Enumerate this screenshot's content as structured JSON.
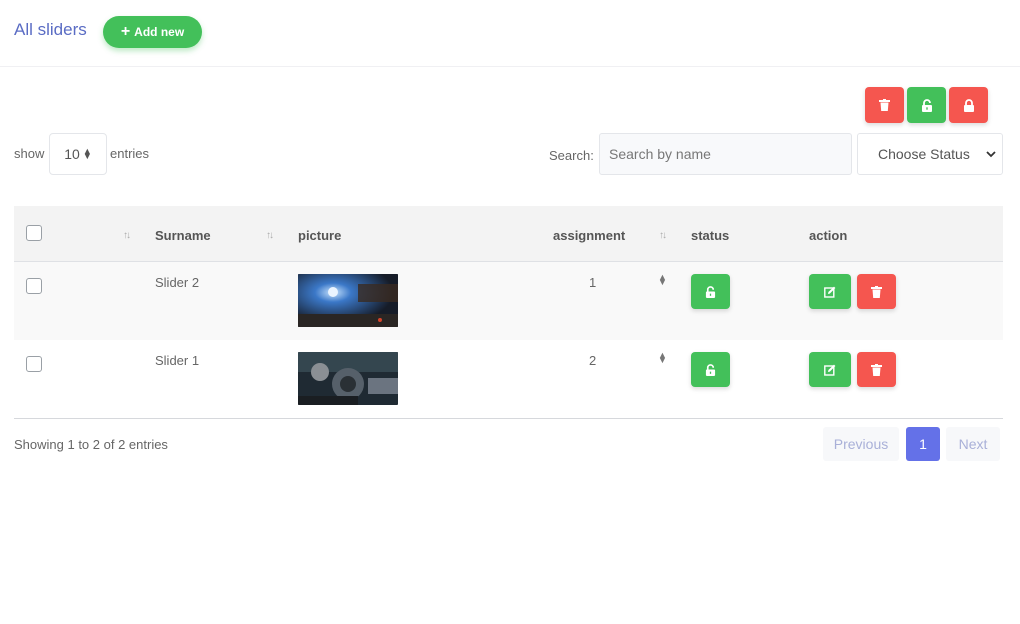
{
  "header": {
    "title": "All sliders",
    "add_label": "Add new"
  },
  "bulk_actions": {
    "delete": "trash-icon",
    "unlock": "unlock-icon",
    "lock": "lock-icon"
  },
  "controls": {
    "show_label": "show",
    "entries_value": "10",
    "entries_label": "entries",
    "search_label": "Search:",
    "search_placeholder": "Search by name",
    "search_value": "",
    "status_select": "Choose Status"
  },
  "table": {
    "columns": [
      "Surname",
      "picture",
      "assignment",
      "status",
      "action"
    ],
    "rows": [
      {
        "surname": "Slider 2",
        "assignment": "1",
        "status": "unlocked"
      },
      {
        "surname": "Slider 1",
        "assignment": "2",
        "status": "unlocked"
      }
    ]
  },
  "footer": {
    "info": "Showing 1 to 2 of 2 entries",
    "previous": "Previous",
    "current_page": "1",
    "next": "Next"
  },
  "colors": {
    "accent": "#6471e8",
    "success": "#43c05a",
    "danger": "#f5564f",
    "title": "#5a6cc4"
  }
}
